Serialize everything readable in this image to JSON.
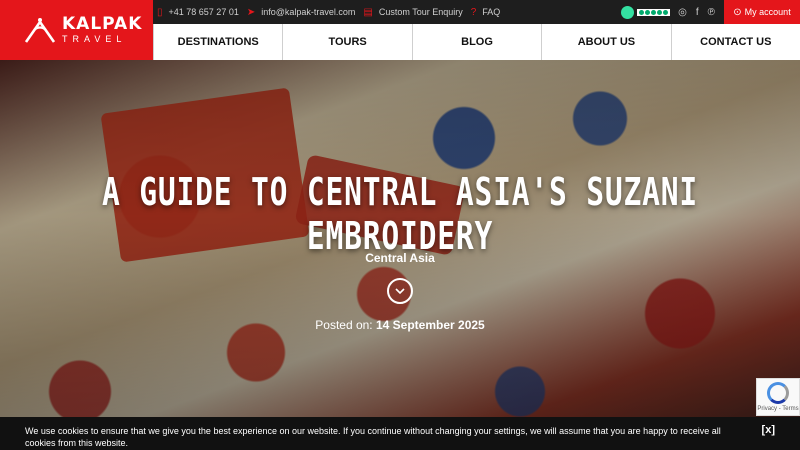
{
  "brand": {
    "name": "KALPAK",
    "sub": "TRAVEL",
    "accent": "#e4161b"
  },
  "topbar": {
    "phone": "+41 78 657 27 01",
    "email": "info@kalpak-travel.com",
    "enquiry": "Custom Tour Enquiry",
    "faq": "FAQ",
    "account": "My account",
    "tripadvisor_rating": 5
  },
  "nav": {
    "items": [
      {
        "label": "DESTINATIONS"
      },
      {
        "label": "TOURS"
      },
      {
        "label": "BLOG"
      },
      {
        "label": "ABOUT US"
      },
      {
        "label": "CONTACT US"
      }
    ]
  },
  "hero": {
    "title": "A Guide to Central Asia's Suzani Embroidery",
    "category": "Central Asia",
    "posted_label": "Posted on:",
    "posted_date": "14 September 2025"
  },
  "recaptcha": {
    "text": "Privacy - Terms"
  },
  "cookie": {
    "text": "We use cookies to ensure that we give you the best experience on our website. If you continue without changing your settings, we will assume that you are happy to receive all cookies from this website.",
    "close_label": "[x]"
  }
}
